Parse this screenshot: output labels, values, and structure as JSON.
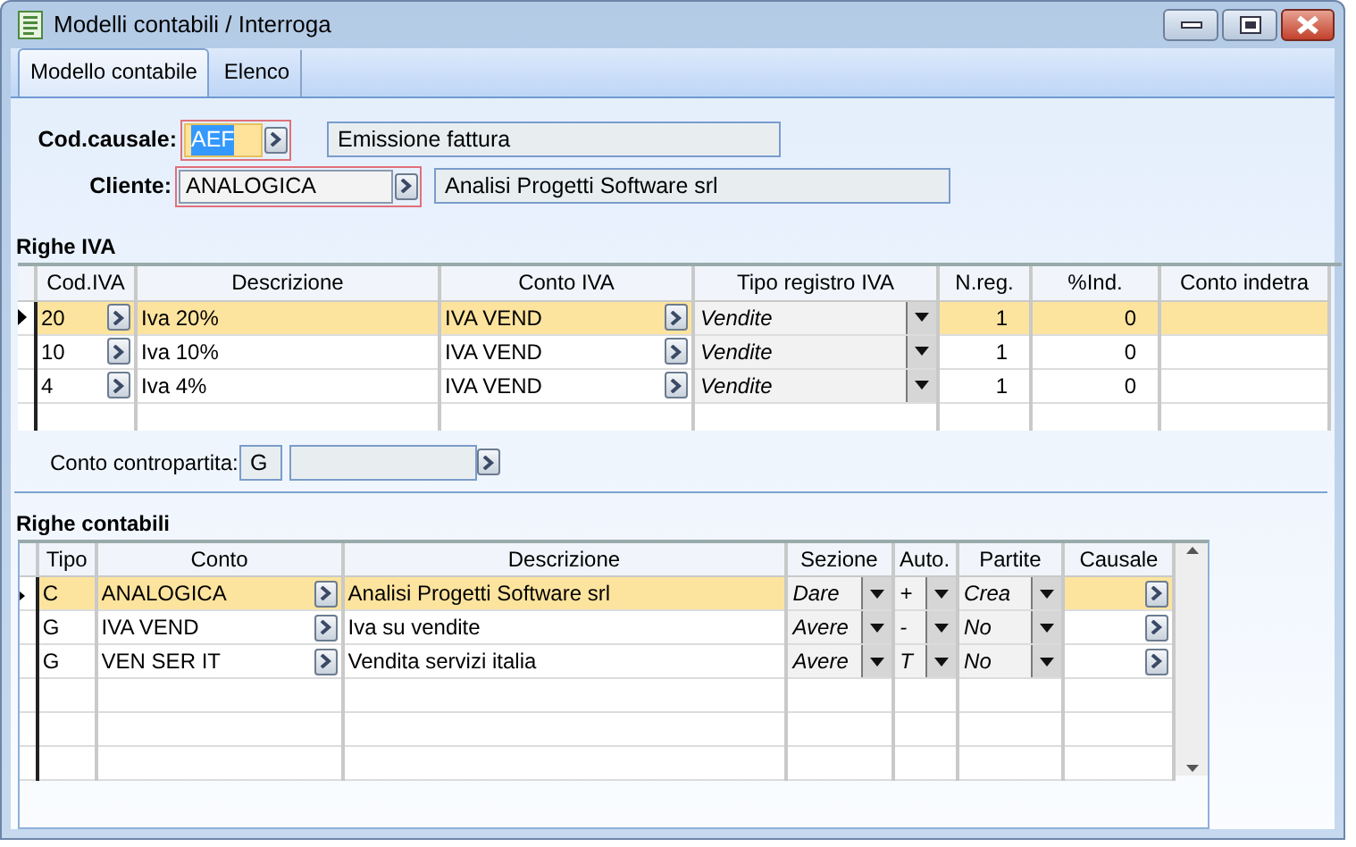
{
  "window": {
    "title": "Modelli contabili / Interroga"
  },
  "tabs": [
    {
      "label": "Modello contabile",
      "selected": true
    },
    {
      "label": "Elenco",
      "selected": false
    }
  ],
  "header_fields": [
    {
      "label": "Cod.causale:",
      "value": "AEF",
      "required": true,
      "focused": true,
      "description": "Emissione fattura"
    },
    {
      "label": "Cliente:",
      "value": "ANALOGICA",
      "required": true,
      "focused": false,
      "description": "Analisi Progetti Software srl"
    }
  ],
  "righe_iva": {
    "title": "Righe IVA",
    "columns": [
      {
        "label": "Cod.IVA",
        "kind": "lookup"
      },
      {
        "label": "Descrizione",
        "kind": "text"
      },
      {
        "label": "Conto IVA",
        "kind": "lookup"
      },
      {
        "label": "Tipo registro IVA",
        "kind": "combo"
      },
      {
        "label": "N.reg.",
        "kind": "number"
      },
      {
        "label": "%Ind.",
        "kind": "number"
      },
      {
        "label": "Conto indetra",
        "kind": "text"
      }
    ],
    "rows": [
      {
        "selected": true,
        "cells": [
          "20",
          "Iva 20%",
          "IVA VEND",
          "Vendite",
          "1",
          "0"
        ]
      },
      {
        "selected": false,
        "cells": [
          "10",
          "Iva 10%",
          "IVA VEND",
          "Vendite",
          "1",
          "0"
        ]
      },
      {
        "selected": false,
        "cells": [
          "4",
          "Iva 4%",
          "IVA VEND",
          "Vendite",
          "1",
          "0"
        ]
      }
    ]
  },
  "conto_contropartita": {
    "label": "Conto contropartita:",
    "type": "G"
  },
  "righe_contabili": {
    "title": "Righe contabili",
    "columns": [
      {
        "label": "Tipo",
        "kind": "text"
      },
      {
        "label": "Conto",
        "kind": "lookup"
      },
      {
        "label": "Descrizione",
        "kind": "text"
      },
      {
        "label": "Sezione",
        "kind": "combo"
      },
      {
        "label": "Auto.",
        "kind": "combo"
      },
      {
        "label": "Partite",
        "kind": "combo"
      },
      {
        "label": "Causale",
        "kind": "lookup"
      }
    ],
    "rows": [
      {
        "selected": true,
        "cells": [
          "C",
          "ANALOGICA",
          "Analisi Progetti Software srl",
          "Dare",
          "+",
          "Crea"
        ]
      },
      {
        "selected": false,
        "cells": [
          "G",
          "IVA VEND",
          "Iva su vendite",
          "Avere",
          "-",
          "No"
        ]
      },
      {
        "selected": false,
        "cells": [
          "G",
          "VEN SER IT",
          "Vendita servizi italia",
          "Avere",
          "T",
          "No"
        ]
      }
    ]
  }
}
